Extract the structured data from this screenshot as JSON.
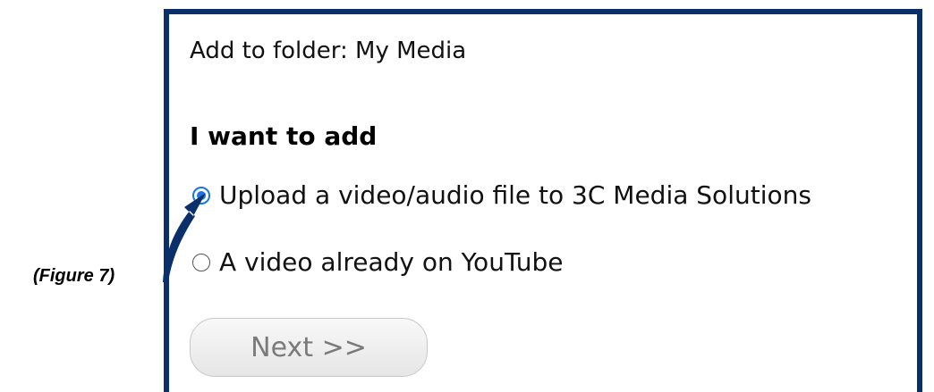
{
  "caption": "(Figure 7)",
  "dialog": {
    "folder_line": "Add to folder: My Media",
    "heading": "I want to add",
    "options": [
      {
        "label": "Upload a video/audio file to 3C Media Solutions",
        "selected": true
      },
      {
        "label": "A video already on YouTube",
        "selected": false
      }
    ],
    "next_label": "Next >>"
  },
  "colors": {
    "frame": "#0a2f6b",
    "radio_selected": "#1a73e8",
    "arrow": "#0a2f6b"
  }
}
